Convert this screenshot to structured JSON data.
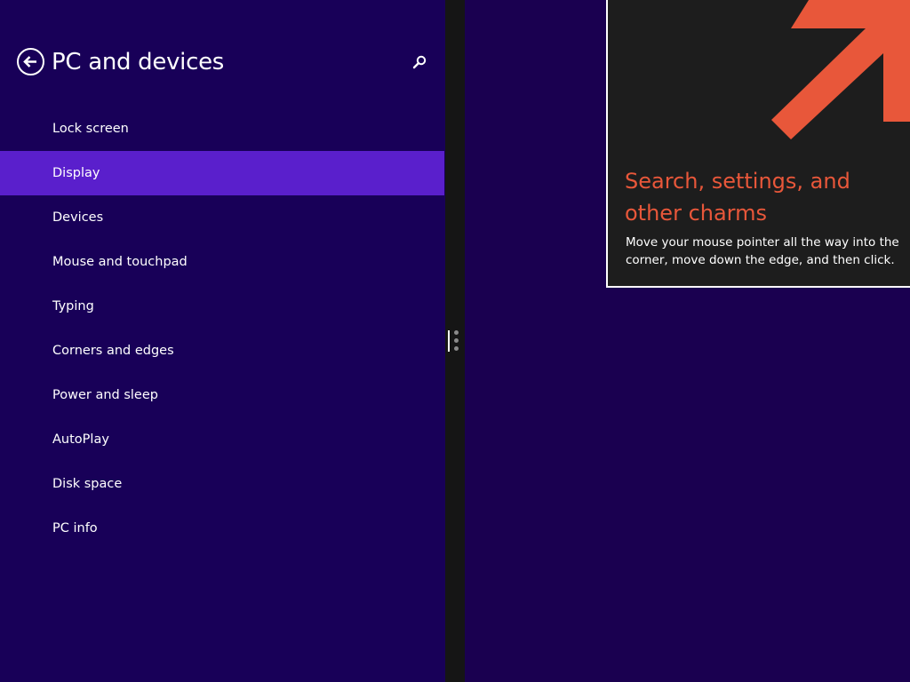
{
  "settings_pane": {
    "title": "PC and devices",
    "back_icon": "back-arrow-circle-icon",
    "search_icon": "search-icon",
    "nav_items": [
      {
        "label": "Lock screen",
        "selected": false
      },
      {
        "label": "Display",
        "selected": true
      },
      {
        "label": "Devices",
        "selected": false
      },
      {
        "label": "Mouse and touchpad",
        "selected": false
      },
      {
        "label": "Typing",
        "selected": false
      },
      {
        "label": "Corners and edges",
        "selected": false
      },
      {
        "label": "Power and sleep",
        "selected": false
      },
      {
        "label": "AutoPlay",
        "selected": false
      },
      {
        "label": "Disk space",
        "selected": false
      },
      {
        "label": "PC info",
        "selected": false
      }
    ]
  },
  "charms_tip": {
    "heading": "Search, settings, and other charms",
    "body": "Move your mouse pointer all the way into the corner, move down the edge, and then click.",
    "arrow_icon": "diagonal-arrow-up-right-icon"
  },
  "colors": {
    "pane_background": "#180058",
    "selected_item": "#5a1fcc",
    "desktop_background": "#1a0050",
    "tip_background": "#1d1d1d",
    "tip_accent": "#e8573a",
    "divider": "#151515"
  }
}
